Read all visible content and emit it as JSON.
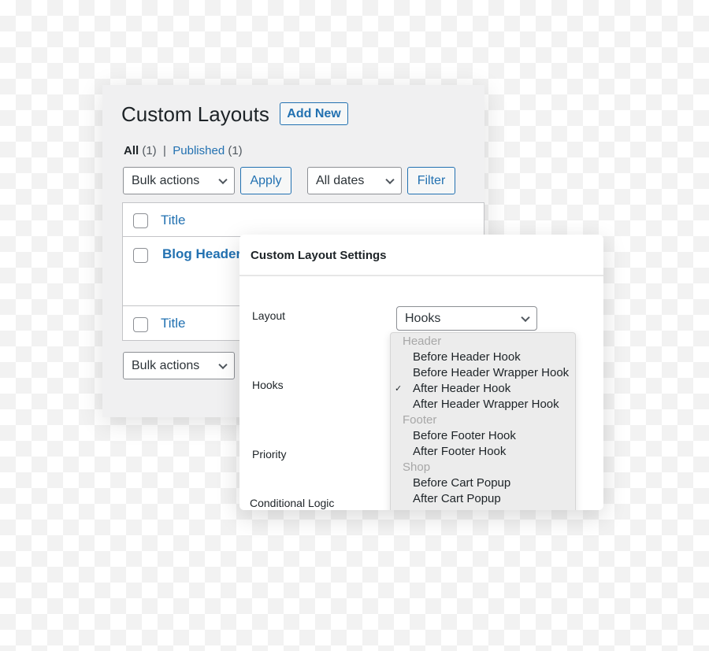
{
  "list": {
    "title": "Custom Layouts",
    "add_new": "Add New",
    "filters": {
      "all": "All",
      "all_count": "(1)",
      "sep": "|",
      "published": "Published",
      "published_count": "(1)"
    },
    "bulk_actions": "Bulk actions",
    "apply": "Apply",
    "all_dates": "All dates",
    "filter": "Filter",
    "column_title": "Title",
    "rows": [
      {
        "title": "Blog Header"
      }
    ],
    "footer_title": "Title",
    "bulk_actions_bottom": "Bulk actions"
  },
  "settings": {
    "title": "Custom Layout Settings",
    "fields": {
      "layout": "Layout",
      "hooks": "Hooks",
      "priority": "Priority",
      "conditional": "Conditional Logic"
    },
    "layout_value": "Hooks",
    "dropdown": [
      {
        "group": "Header"
      },
      {
        "label": "Before Header Hook"
      },
      {
        "label": "Before Header Wrapper Hook"
      },
      {
        "label": "After Header Hook",
        "checked": true
      },
      {
        "label": "After Header Wrapper Hook"
      },
      {
        "group": "Footer"
      },
      {
        "label": "Before Footer Hook"
      },
      {
        "label": "After Footer Hook"
      },
      {
        "group": "Shop"
      },
      {
        "label": "Before Cart Popup"
      },
      {
        "label": "After Cart Popup"
      }
    ],
    "check": "✓"
  },
  "colors": {
    "accent": "#2271b1",
    "panel_bg": "#f0f0f1",
    "dropdown_bg": "#ececec"
  }
}
